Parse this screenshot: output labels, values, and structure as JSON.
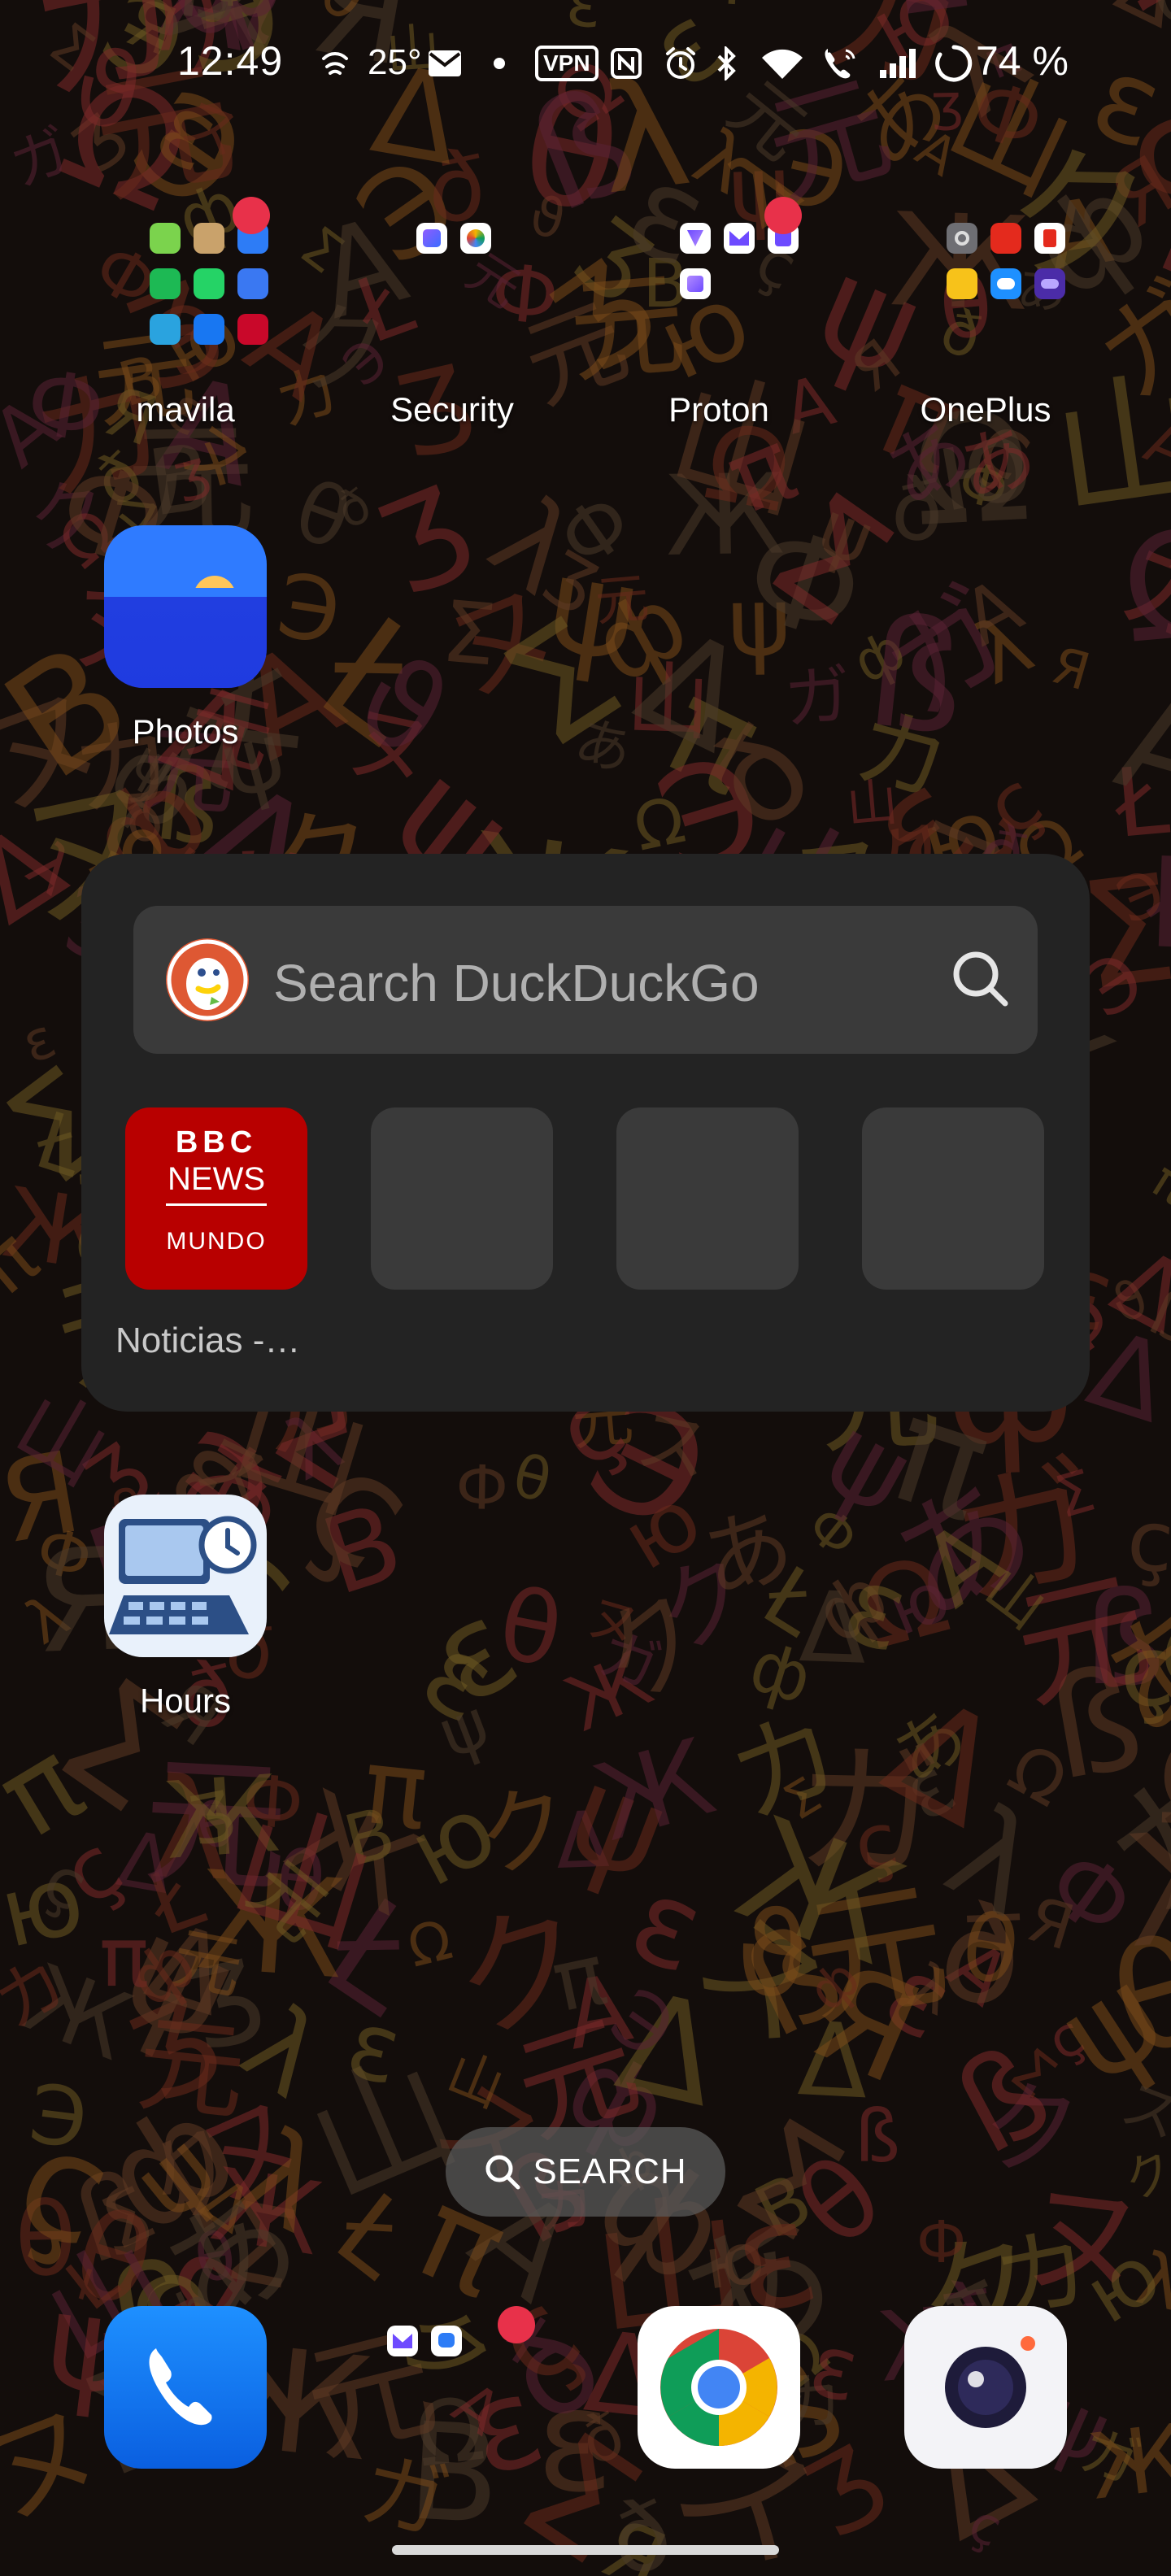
{
  "status_bar": {
    "time": "12:49",
    "temperature": "25°",
    "vpn": "VPN",
    "battery": "74 %",
    "icons": [
      "fan-icon",
      "mail-icon",
      "dot-icon",
      "vpn-icon",
      "nfc-icon",
      "alarm-icon",
      "bluetooth-icon",
      "wifi-icon",
      "wifi-calling-icon",
      "signal-icon",
      "battery-saver-icon"
    ]
  },
  "folders": [
    {
      "label": "mavila",
      "badge": true
    },
    {
      "label": "Security",
      "badge": false
    },
    {
      "label": "Proton",
      "badge": true
    },
    {
      "label": "OnePlus",
      "badge": false
    }
  ],
  "apps": {
    "photos": "Photos",
    "hours": "Hours"
  },
  "widget": {
    "search_placeholder": "Search DuckDuckGo",
    "bbc_line1": "BBC",
    "bbc_line2": "NEWS",
    "bbc_line3": "MUNDO",
    "caption": "Noticias -…"
  },
  "search_pill": {
    "label": "SEARCH"
  },
  "dock": [
    "phone-icon",
    "proton-folder",
    "chrome-icon",
    "camera-icon"
  ],
  "colors": {
    "badge": "#e8314a",
    "bbc_red": "#b80000",
    "widget_bg": "#232323",
    "ddg_orange": "#de5833"
  }
}
